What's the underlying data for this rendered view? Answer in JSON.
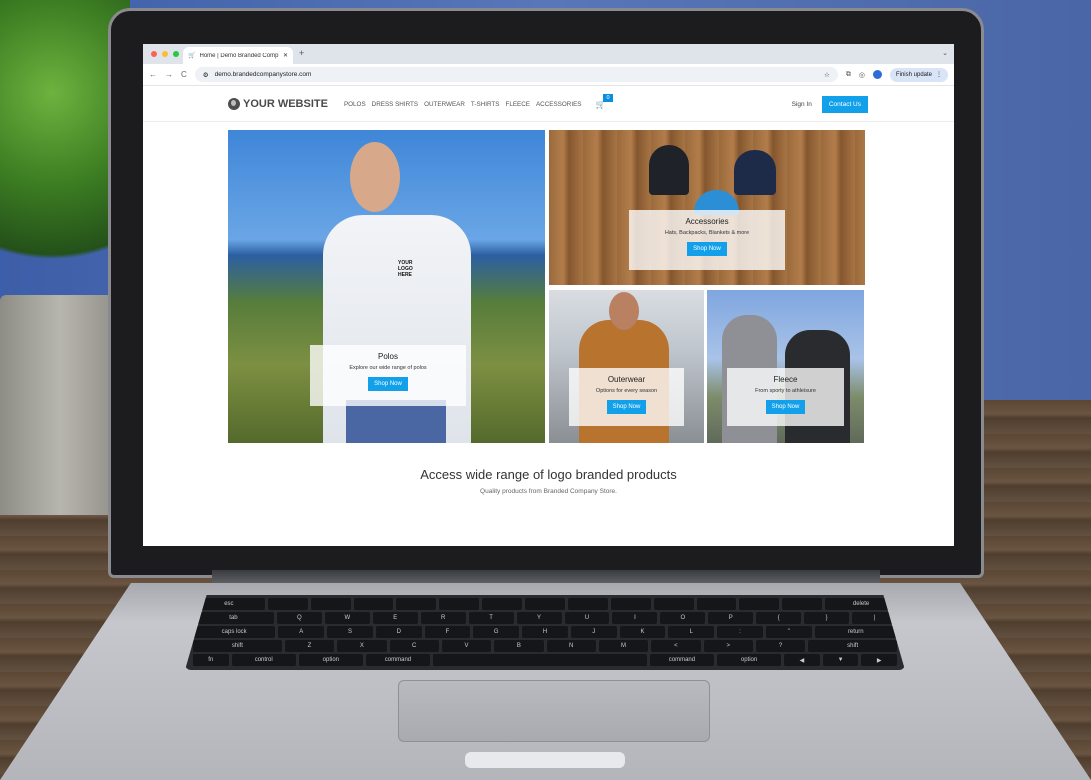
{
  "browser": {
    "tab_title": "Home | Demo Branded Comp",
    "new_tab": "+",
    "tab_menu": "⌄",
    "url": "demo.brandedcompanystore.com",
    "update_button": "Finish update",
    "back": "←",
    "forward": "→",
    "reload": "C"
  },
  "site": {
    "logo": "YOUR WEBSITE",
    "menu": [
      "POLOS",
      "DRESS SHIRTS",
      "OUTERWEAR",
      "T-SHIRTS",
      "FLEECE",
      "ACCESSORIES"
    ],
    "cart_count": "0",
    "signin": "Sign In",
    "contact": "Contact Us",
    "tiles": {
      "polos": {
        "title": "Polos",
        "subtitle": "Explore our wide range of polos",
        "button": "Shop Now"
      },
      "accessories": {
        "title": "Accessories",
        "subtitle": "Hats, Backpacks, Blankets & more",
        "button": "Shop Now"
      },
      "outerwear": {
        "title": "Outerwear",
        "subtitle": "Options for every season",
        "button": "Shop Now"
      },
      "fleece": {
        "title": "Fleece",
        "subtitle": "From sporty to athleisure",
        "button": "Shop Now"
      }
    },
    "logo_placeholder": "YOUR LOGO HERE",
    "tagline": "Access wide range of logo branded products",
    "subtagline": "Quality products from Branded Company Store."
  },
  "keyboard": {
    "row1": [
      "esc",
      "",
      "",
      "",
      "",
      "",
      "",
      "",
      "",
      "",
      "",
      "",
      "",
      "",
      "delete"
    ],
    "row2": [
      "tab",
      "Q",
      "W",
      "E",
      "R",
      "T",
      "Y",
      "U",
      "I",
      "O",
      "P",
      "{",
      "}",
      "|"
    ],
    "row3": [
      "caps lock",
      "A",
      "S",
      "D",
      "F",
      "G",
      "H",
      "J",
      "K",
      "L",
      ":",
      "\"",
      "return"
    ],
    "row4": [
      "shift",
      "Z",
      "X",
      "C",
      "V",
      "B",
      "N",
      "M",
      "<",
      ">",
      "?",
      "shift"
    ],
    "row5": [
      "fn",
      "control",
      "option",
      "command",
      "",
      "command",
      "option",
      "◀",
      "▼",
      "▶"
    ]
  },
  "colors": {
    "accent": "#12a0ea",
    "traffic_red": "#ff5f57",
    "traffic_yellow": "#febc2e",
    "traffic_green": "#28c840"
  }
}
